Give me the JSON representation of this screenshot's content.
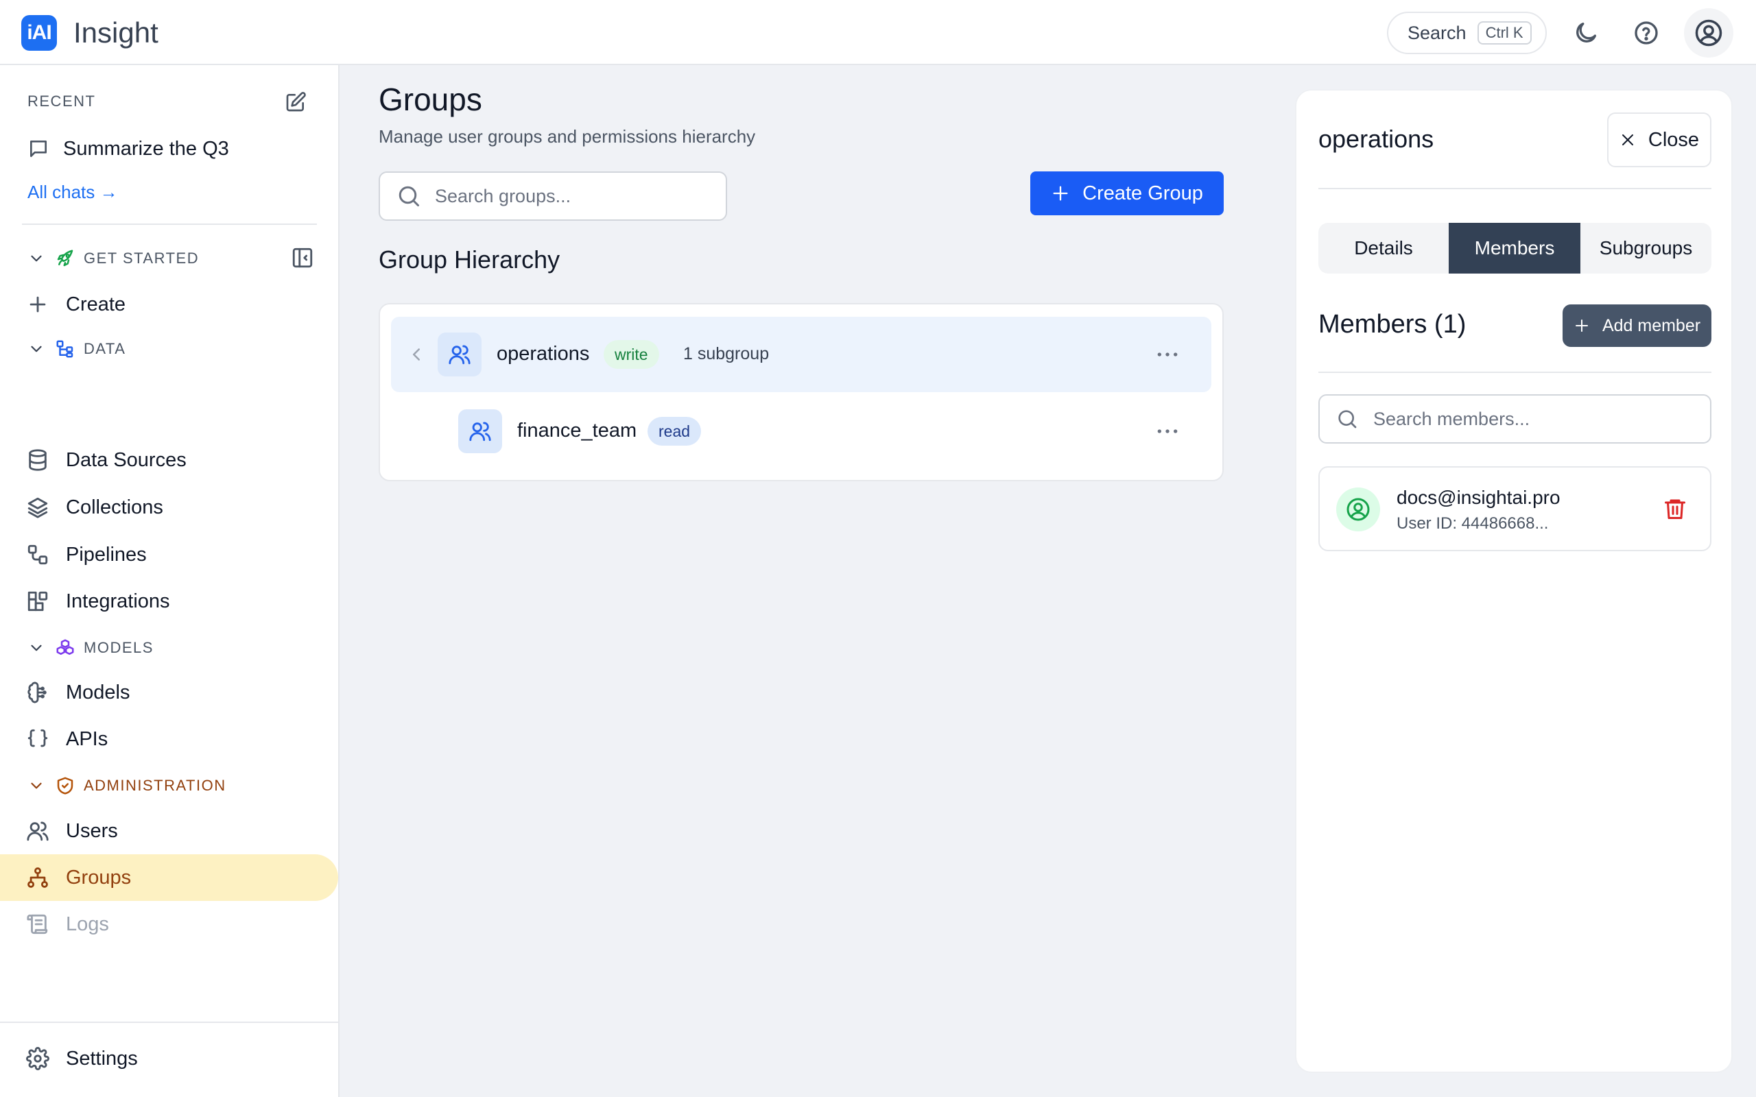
{
  "header": {
    "logo_text": "iAI",
    "app_title": "Insight",
    "search_label": "Search",
    "search_shortcut": "Ctrl K"
  },
  "sidebar": {
    "recent_label": "RECENT",
    "recent_items": [
      {
        "label": "Summarize the Q3"
      }
    ],
    "all_chats": "All chats →",
    "sections": {
      "get_started": {
        "label": "GET STARTED",
        "color": "#15803d"
      },
      "data": {
        "label": "DATA",
        "color": "#2563eb"
      },
      "models": {
        "label": "MODELS",
        "color": "#7c3aed"
      },
      "administration": {
        "label": "ADMINISTRATION",
        "color": "#b45309"
      }
    },
    "items": [
      {
        "label": "Create"
      },
      {
        "label": "Data Sources"
      },
      {
        "label": "Collections"
      },
      {
        "label": "Pipelines"
      },
      {
        "label": "Integrations"
      },
      {
        "label": "Models"
      },
      {
        "label": "APIs"
      },
      {
        "label": "Users"
      },
      {
        "label": "Groups"
      },
      {
        "label": "Logs"
      }
    ],
    "settings": "Settings"
  },
  "main": {
    "title": "Groups",
    "subtitle": "Manage user groups and permissions hierarchy",
    "search_placeholder": "Search groups...",
    "create_button": "Create Group",
    "hierarchy_title": "Group Hierarchy",
    "groups": [
      {
        "name": "operations",
        "permission": "write",
        "subgroups": "1 subgroup"
      },
      {
        "name": "finance_team",
        "permission": "read"
      }
    ]
  },
  "panel": {
    "title": "operations",
    "close_label": "Close",
    "tabs": [
      "Details",
      "Members",
      "Subgroups"
    ],
    "active_tab": "Members",
    "members_title": "Members (1)",
    "add_member": "Add member",
    "search_placeholder": "Search members...",
    "members": [
      {
        "email": "docs@insightai.pro",
        "user_id": "User ID: 44486668..."
      }
    ]
  },
  "colors": {
    "brand": "#1d6ff2",
    "primary_button": "#1a5cf5",
    "active_nav_bg": "#fdf1c2",
    "active_tab_bg": "#334155",
    "danger": "#dc2626"
  }
}
